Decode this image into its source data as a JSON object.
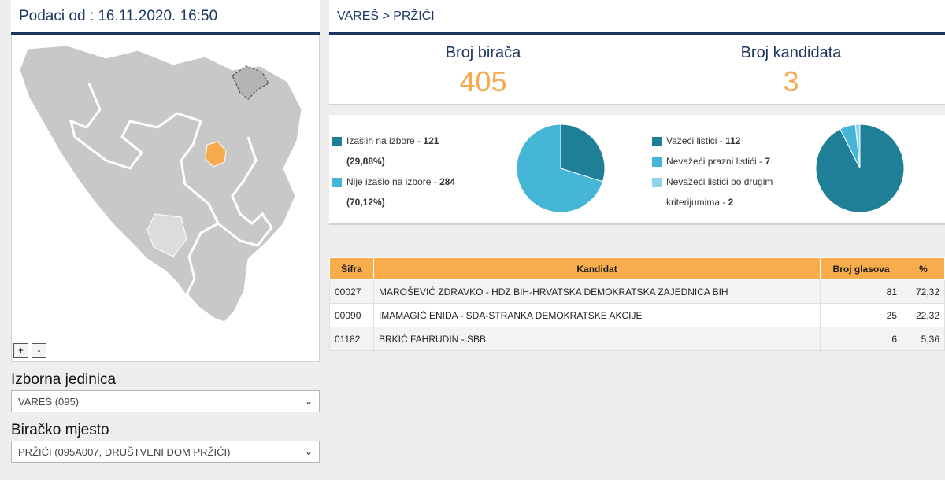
{
  "header": {
    "data_time": "Podaci od : 16.11.2020. 16:50"
  },
  "map": {
    "zoom_in": "+",
    "zoom_out": "-",
    "highlight_color": "#f7a94e",
    "base_color": "#c8c8c8"
  },
  "filters": {
    "unit_label": "Izborna jedinica",
    "unit_value": "VAREŠ (095)",
    "station_label": "Biračko mjesto",
    "station_value": "PRŽIĆI (095A007, DRUŠTVENI DOM PRŽIĆI)"
  },
  "breadcrumb": "VAREŠ > PRŽIĆI",
  "stats": {
    "voters_label": "Broj birača",
    "voters_value": "405",
    "candidates_label": "Broj kandidata",
    "candidates_value": "3"
  },
  "turnout": {
    "items": [
      {
        "label": "Izašlih na izbore - ",
        "value": "121",
        "pct": "(29,88%)",
        "fraction": 0.2988,
        "color": "#1f7f96"
      },
      {
        "label": "Nije izašlo na izbore - ",
        "value": "284",
        "pct": "(70,12%)",
        "fraction": 0.7012,
        "color": "#45b6d6"
      }
    ]
  },
  "ballots": {
    "items": [
      {
        "label": "Važeći listići - ",
        "value": "112",
        "fraction": 0.9256,
        "color": "#1f7f96"
      },
      {
        "label": "Nevažeći prazni listići - ",
        "value": "7",
        "fraction": 0.0579,
        "color": "#45b6d6"
      },
      {
        "label": "Nevažeći listići po drugim kriterijumima - ",
        "value": "2",
        "fraction": 0.0165,
        "color": "#93d3e8"
      }
    ]
  },
  "table": {
    "headers": {
      "code": "Šifra",
      "candidate": "Kandidat",
      "votes": "Broj glasova",
      "pct": "%"
    },
    "rows": [
      {
        "code": "00027",
        "candidate": "MAROŠEVIĆ ZDRAVKO - HDZ BIH-HRVATSKA DEMOKRATSKA ZAJEDNICA BIH",
        "votes": "81",
        "pct": "72,32"
      },
      {
        "code": "00090",
        "candidate": "IMAMAGIĆ ENIDA - SDA-STRANKA DEMOKRATSKE AKCIJE",
        "votes": "25",
        "pct": "22,32"
      },
      {
        "code": "01182",
        "candidate": "BRKIĆ FAHRUDIN - SBB",
        "votes": "6",
        "pct": "5,36"
      }
    ]
  }
}
